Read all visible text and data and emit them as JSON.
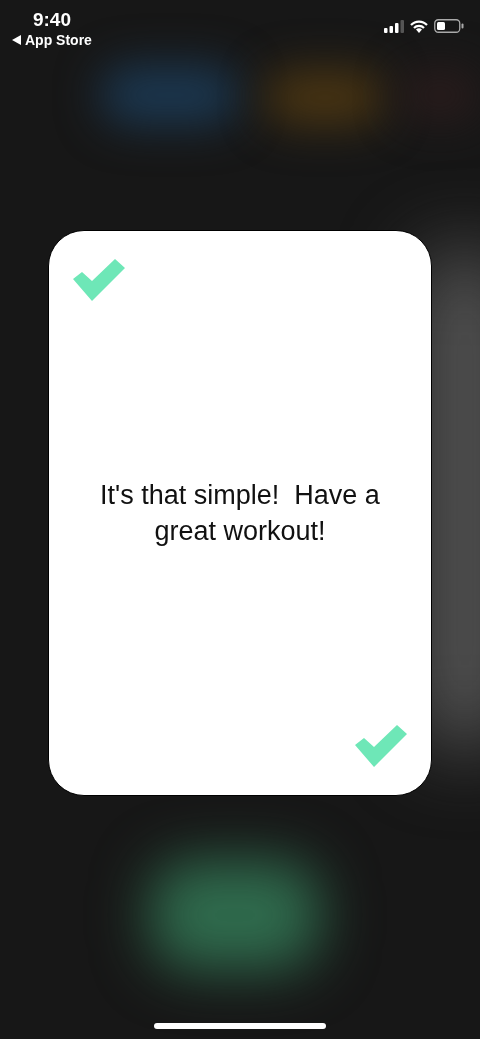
{
  "status_bar": {
    "time": "9:40",
    "back_label": "App Store"
  },
  "card": {
    "message": "It's that simple!  Have a great workout!"
  }
}
